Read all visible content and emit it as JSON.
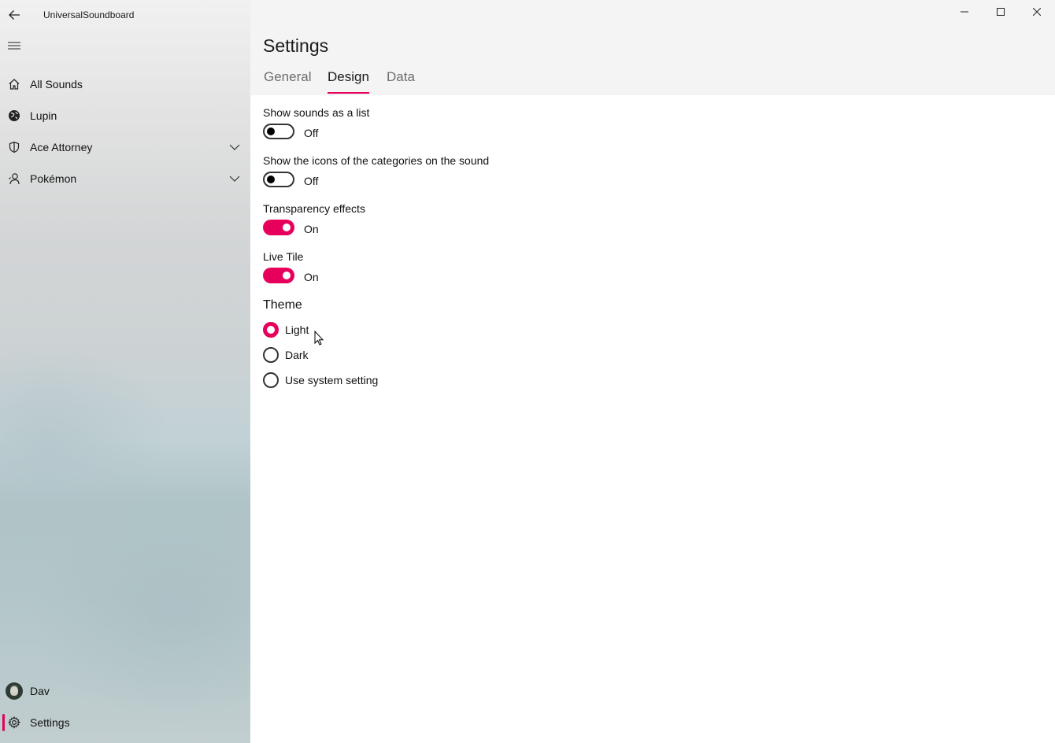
{
  "app": {
    "title": "UniversalSoundboard"
  },
  "sidebar": {
    "items": [
      {
        "label": "All Sounds",
        "icon": "home-icon"
      },
      {
        "label": "Lupin",
        "icon": "globe-icon"
      },
      {
        "label": "Ace Attorney",
        "icon": "shield-icon",
        "expandable": true
      },
      {
        "label": "Pokémon",
        "icon": "person-icon",
        "expandable": true
      }
    ],
    "footer": {
      "user": "Dav",
      "settings": "Settings"
    }
  },
  "page": {
    "title": "Settings",
    "tabs": [
      {
        "label": "General",
        "active": false
      },
      {
        "label": "Design",
        "active": true
      },
      {
        "label": "Data",
        "active": false
      }
    ]
  },
  "settings": {
    "list": {
      "label": "Show sounds as a list",
      "state": "Off"
    },
    "icons": {
      "label": "Show the icons of the categories on the sound",
      "state": "Off"
    },
    "transparency": {
      "label": "Transparency effects",
      "state": "On"
    },
    "livetile": {
      "label": "Live Tile",
      "state": "On"
    }
  },
  "theme": {
    "title": "Theme",
    "options": [
      "Light",
      "Dark",
      "Use system setting"
    ],
    "selected": "Light"
  },
  "colors": {
    "accent": "#e6005c"
  }
}
